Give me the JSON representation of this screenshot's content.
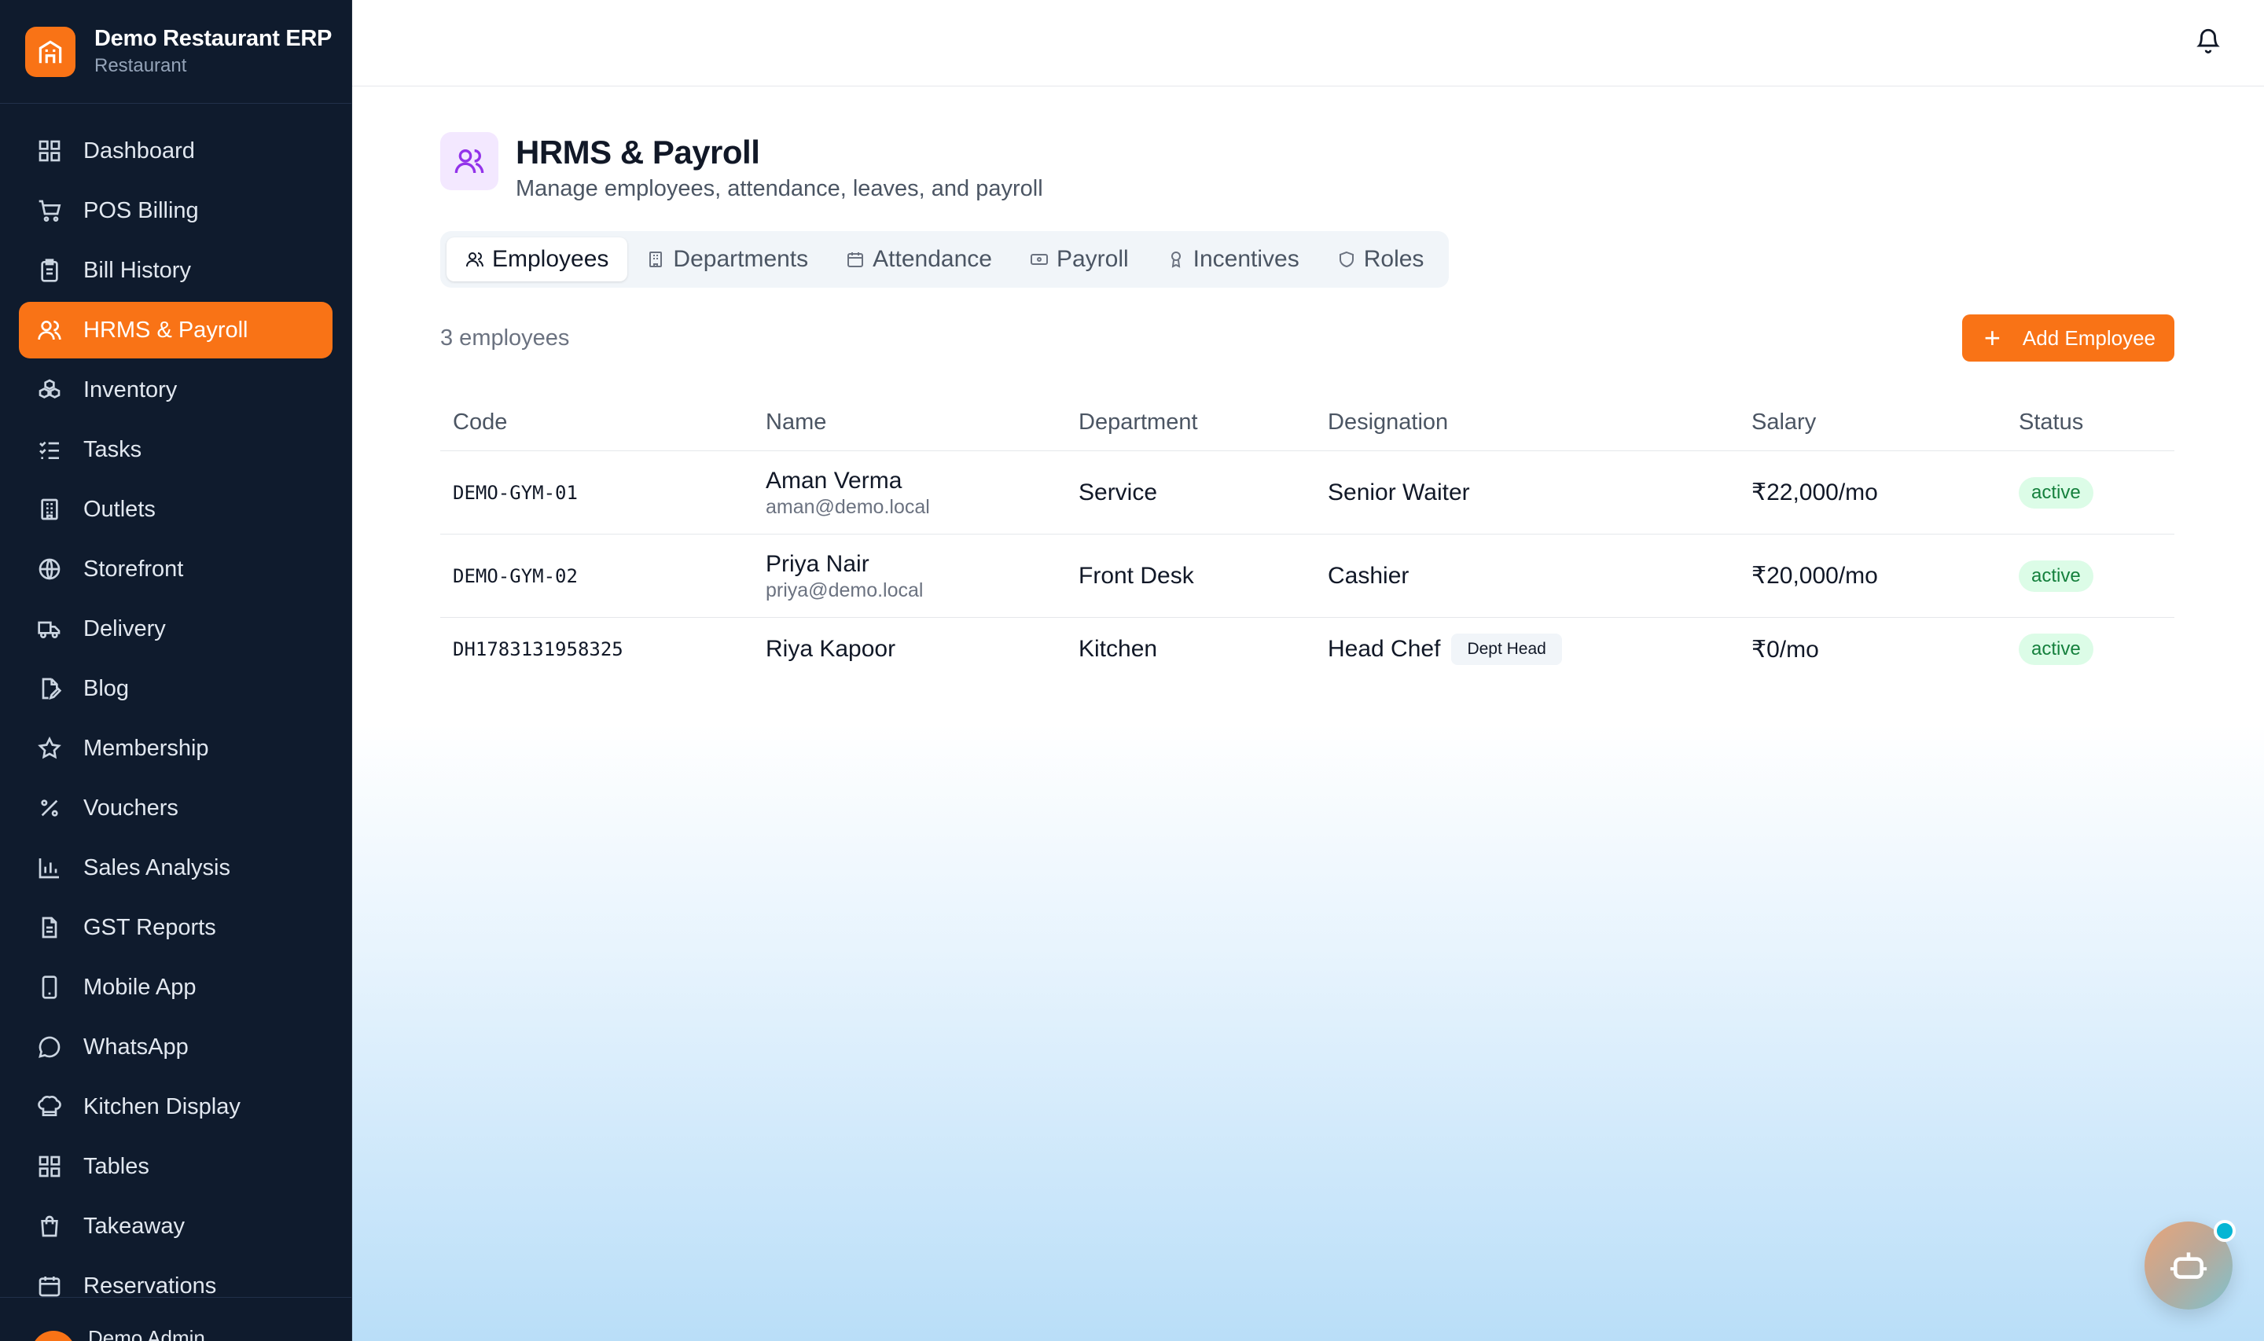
{
  "brand": {
    "name": "Demo Restaurant ERP",
    "type": "Restaurant"
  },
  "sidebar": {
    "items": [
      {
        "label": "Dashboard",
        "icon": "dashboard-icon"
      },
      {
        "label": "POS Billing",
        "icon": "cart-icon"
      },
      {
        "label": "Bill History",
        "icon": "clipboard-icon"
      },
      {
        "label": "HRMS & Payroll",
        "icon": "users-icon",
        "active": true
      },
      {
        "label": "Inventory",
        "icon": "boxes-icon"
      },
      {
        "label": "Tasks",
        "icon": "checklist-icon"
      },
      {
        "label": "Outlets",
        "icon": "building-icon"
      },
      {
        "label": "Storefront",
        "icon": "globe-icon"
      },
      {
        "label": "Delivery",
        "icon": "truck-icon"
      },
      {
        "label": "Blog",
        "icon": "file-edit-icon"
      },
      {
        "label": "Membership",
        "icon": "star-icon"
      },
      {
        "label": "Vouchers",
        "icon": "percent-icon"
      },
      {
        "label": "Sales Analysis",
        "icon": "bar-chart-icon"
      },
      {
        "label": "GST Reports",
        "icon": "document-icon"
      },
      {
        "label": "Mobile App",
        "icon": "smartphone-icon"
      },
      {
        "label": "WhatsApp",
        "icon": "chat-icon"
      },
      {
        "label": "Kitchen Display",
        "icon": "chef-hat-icon"
      },
      {
        "label": "Tables",
        "icon": "grid-icon"
      },
      {
        "label": "Takeaway",
        "icon": "bag-icon"
      },
      {
        "label": "Reservations",
        "icon": "calendar-icon"
      }
    ],
    "footer_user": "Demo Admin"
  },
  "page": {
    "title": "HRMS & Payroll",
    "subtitle": "Manage employees, attendance, leaves, and payroll"
  },
  "tabs": [
    {
      "label": "Employees",
      "active": true
    },
    {
      "label": "Departments"
    },
    {
      "label": "Attendance"
    },
    {
      "label": "Payroll"
    },
    {
      "label": "Incentives"
    },
    {
      "label": "Roles"
    }
  ],
  "employees_count": "3 employees",
  "add_button": "Add Employee",
  "table": {
    "headers": [
      "Code",
      "Name",
      "Department",
      "Designation",
      "Salary",
      "Status"
    ],
    "rows": [
      {
        "code": "DEMO-GYM-01",
        "name": "Aman Verma",
        "email": "aman@demo.local",
        "department": "Service",
        "designation": "Senior Waiter",
        "badge": "",
        "salary": "₹22,000/mo",
        "status": "active"
      },
      {
        "code": "DEMO-GYM-02",
        "name": "Priya Nair",
        "email": "priya@demo.local",
        "department": "Front Desk",
        "designation": "Cashier",
        "badge": "",
        "salary": "₹20,000/mo",
        "status": "active"
      },
      {
        "code": "DH1783131958325",
        "name": "Riya Kapoor",
        "email": "",
        "department": "Kitchen",
        "designation": "Head Chef",
        "badge": "Dept Head",
        "salary": "₹0/mo",
        "status": "active"
      }
    ]
  },
  "colors": {
    "accent": "#f97316",
    "sidebar_bg": "#0f1b2d",
    "status_active_bg": "#dcfce7",
    "status_active_text": "#15803d"
  }
}
